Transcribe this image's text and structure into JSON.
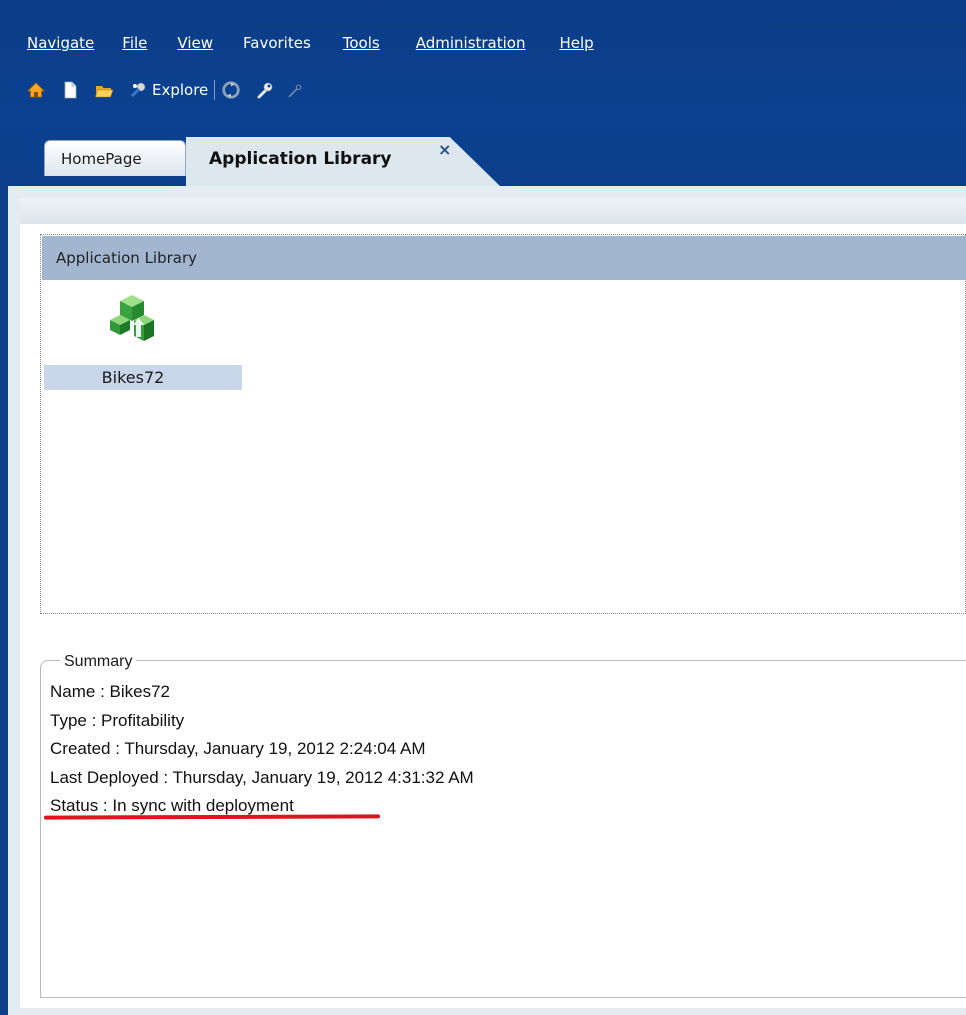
{
  "menu": {
    "items": [
      {
        "label": "Navigate"
      },
      {
        "label": "File"
      },
      {
        "label": "View"
      },
      {
        "label": "Favorites"
      },
      {
        "label": "Tools"
      },
      {
        "label": "Administration"
      },
      {
        "label": "Help"
      }
    ]
  },
  "toolbar": {
    "explore_label": "Explore",
    "icons": [
      "home-icon",
      "new-document-icon",
      "open-folder-icon",
      "explore-icon",
      "refresh-icon",
      "wrench-icon",
      "wrench-disabled-icon"
    ]
  },
  "tabs": {
    "home_label": "HomePage",
    "active_label": "Application Library",
    "close_glyph": "×"
  },
  "library": {
    "header": "Application Library",
    "app_name": "Bikes72"
  },
  "summary": {
    "legend": "Summary",
    "lines": [
      "Name : Bikes72",
      "Type : Profitability",
      "Created : Thursday, January 19, 2012 2:24:04 AM",
      "Last Deployed : Thursday, January 19, 2012 4:31:32 AM",
      "Status : In sync with deployment"
    ]
  },
  "colors": {
    "header_blue": "#0b3f8a",
    "panel_header": "#a3b6cf",
    "selection": "#c9d6e9",
    "annotation_red": "#e0141e"
  }
}
